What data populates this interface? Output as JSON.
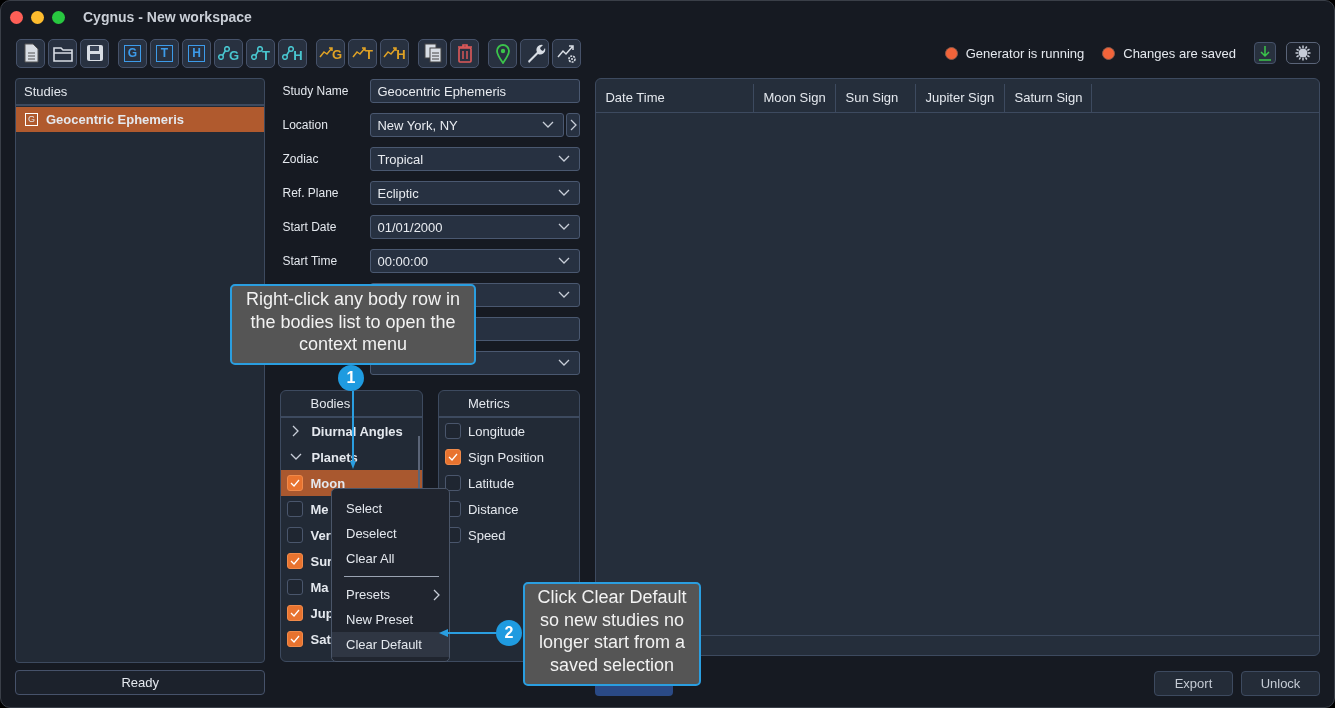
{
  "window": {
    "title": "Cygnus - New workspace"
  },
  "toolbar": {
    "tools": [
      {
        "kind": "file"
      },
      {
        "kind": "folder"
      },
      {
        "kind": "save"
      },
      {
        "kind": "frame",
        "letter": "G"
      },
      {
        "kind": "frame",
        "letter": "T"
      },
      {
        "kind": "frame",
        "letter": "H"
      },
      {
        "kind": "node",
        "letter": "G"
      },
      {
        "kind": "node",
        "letter": "T"
      },
      {
        "kind": "node",
        "letter": "H"
      },
      {
        "kind": "trend",
        "letter": "G"
      },
      {
        "kind": "trend",
        "letter": "T"
      },
      {
        "kind": "trend",
        "letter": "H"
      },
      {
        "kind": "copy"
      },
      {
        "kind": "trash"
      },
      {
        "kind": "pin"
      },
      {
        "kind": "wrench"
      },
      {
        "kind": "trend-gear"
      }
    ],
    "status": [
      {
        "label": "Generator is running"
      },
      {
        "label": "Changes are saved"
      }
    ],
    "theme_toggle": {
      "on": true
    }
  },
  "studies": {
    "title": "Studies",
    "items": [
      {
        "label": "Geocentric Ephemeris",
        "letter": "G",
        "selected": true
      }
    ],
    "status_button": "Ready"
  },
  "form": {
    "fields": [
      {
        "kind": "text",
        "label": "Study Name",
        "value": "Geocentric Ephemeris"
      },
      {
        "kind": "dropdown-link",
        "label": "Location",
        "value": "New York, NY"
      },
      {
        "kind": "dropdown",
        "label": "Zodiac",
        "value": "Tropical"
      },
      {
        "kind": "dropdown",
        "label": "Ref. Plane",
        "value": "Ecliptic"
      },
      {
        "kind": "dropdown",
        "label": "Start Date",
        "value": "01/01/2000"
      },
      {
        "kind": "dropdown",
        "label": "Start Time",
        "value": "00:00:00"
      },
      {
        "kind": "dropdown"
      },
      {
        "kind": "text"
      },
      {
        "kind": "dropdown"
      }
    ]
  },
  "bodies": {
    "title": "Bodies",
    "groups": [
      {
        "label": "Diurnal Angles",
        "expanded": false
      },
      {
        "label": "Planets",
        "expanded": true,
        "children": [
          {
            "label": "Moon",
            "checked": true,
            "selected": true
          },
          {
            "label": "Me",
            "checked": false,
            "selected": false
          },
          {
            "label": "Ver",
            "checked": false,
            "selected": false
          },
          {
            "label": "Sur",
            "checked": true,
            "selected": false
          },
          {
            "label": "Ma",
            "checked": false,
            "selected": false
          },
          {
            "label": "Jup",
            "checked": true,
            "selected": false
          },
          {
            "label": "Sat",
            "checked": true,
            "selected": false
          }
        ]
      }
    ]
  },
  "metrics": {
    "title": "Metrics",
    "items": [
      {
        "label": "Longitude",
        "checked": false
      },
      {
        "label": "Sign Position",
        "checked": true
      },
      {
        "label": "Latitude",
        "checked": false
      },
      {
        "label": "Distance",
        "checked": false
      },
      {
        "label": "Speed",
        "checked": false
      }
    ]
  },
  "results": {
    "columns": [
      "Date Time",
      "Moon Sign",
      "Sun Sign",
      "Jupiter Sign",
      "Saturn Sign"
    ],
    "actions": [
      "Export",
      "Unlock"
    ]
  },
  "context_menu": {
    "items": [
      {
        "kind": "item",
        "label": "Select",
        "selected": false
      },
      {
        "kind": "item",
        "label": "Deselect",
        "selected": false
      },
      {
        "kind": "item",
        "label": "Clear All",
        "selected": false
      },
      {
        "kind": "separator"
      },
      {
        "kind": "submenu",
        "label": "Presets",
        "selected": false
      },
      {
        "kind": "item",
        "label": "New Preset",
        "selected": false
      },
      {
        "kind": "item",
        "label": "Clear Default",
        "selected": true
      }
    ]
  },
  "callouts": [
    {
      "number": "1",
      "text": "Right-click any body row in the bodies list to open the context menu"
    },
    {
      "number": "2",
      "text": "Click Clear Default so new studies no longer start from a saved selection"
    }
  ]
}
